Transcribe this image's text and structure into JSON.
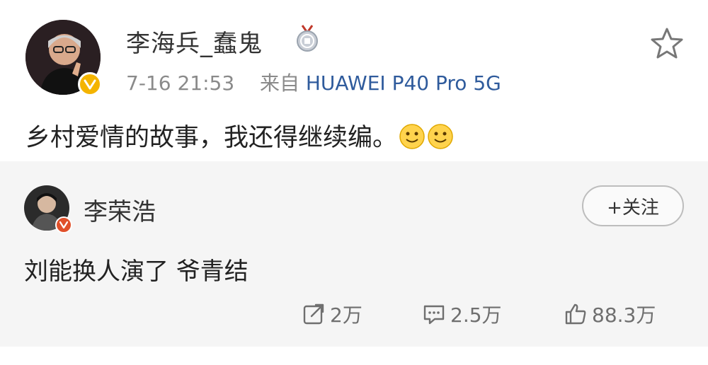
{
  "post": {
    "author": "李海兵_蠢鬼",
    "time": "7-16 21:53",
    "source_prefix": "来自",
    "source_device": "HUAWEI P40 Pro 5G",
    "text": "乡村爱情的故事，我还得继续编。",
    "emoji_count": 2,
    "icons": [
      "verified-badge-icon",
      "medal-icon",
      "star-icon",
      "smile-emoji-icon"
    ]
  },
  "comment": {
    "author": "李荣浩",
    "follow_label": "+关注",
    "text": "刘能换人演了 爷青结"
  },
  "actions": {
    "repost_count": "2万",
    "comment_count": "2.5万",
    "like_count": "88.3万"
  },
  "colors": {
    "link_blue": "#2f5b9c",
    "meta_gray": "#8a8a8a",
    "badge_yellow": "#f4b400",
    "card_bg": "#f5f5f5"
  }
}
